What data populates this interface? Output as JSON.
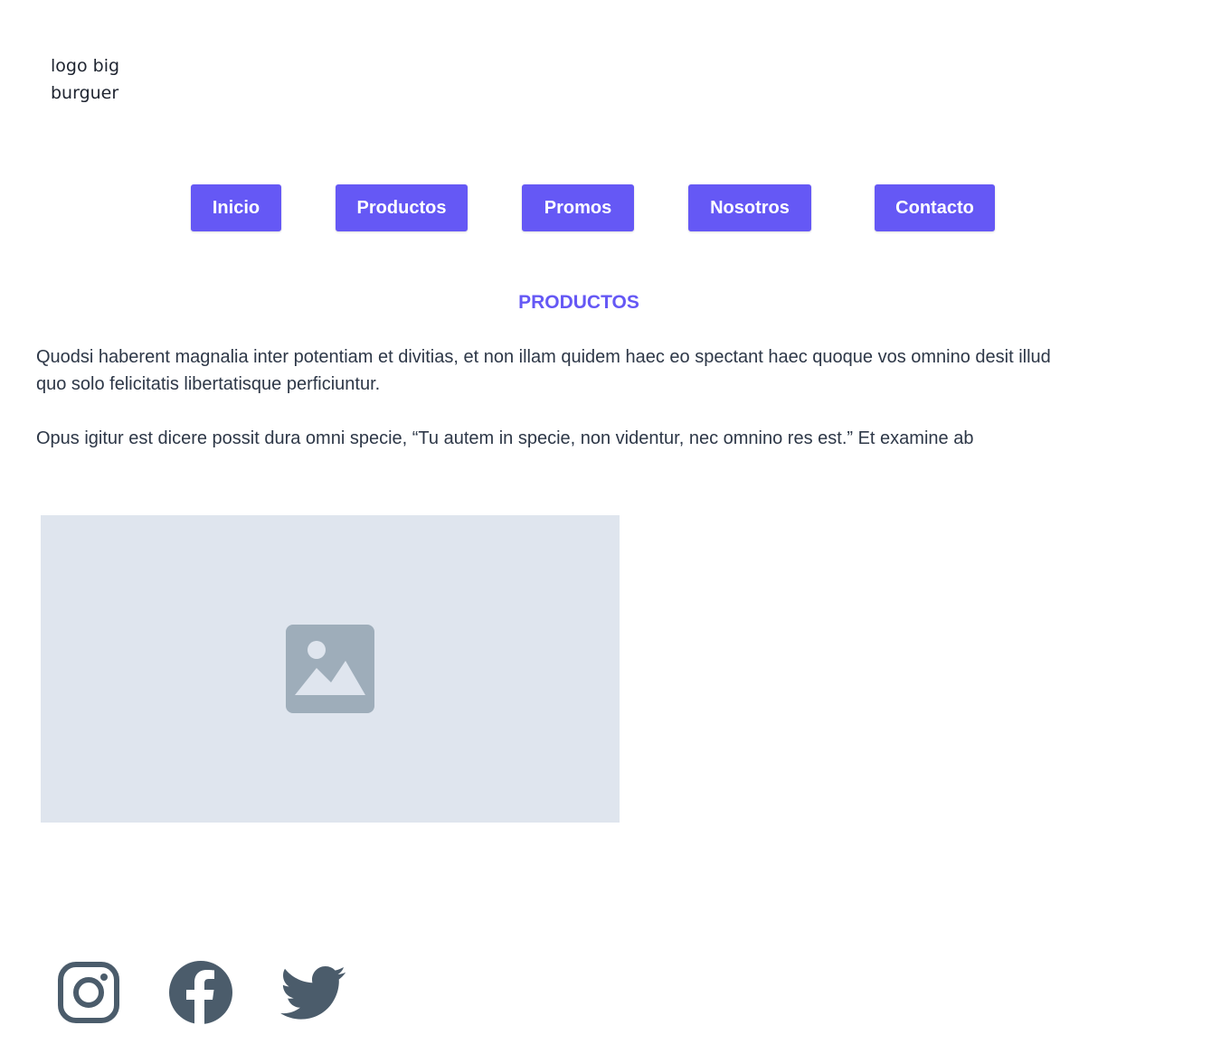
{
  "header": {
    "logo_text": "logo big burguer"
  },
  "nav": {
    "items": [
      {
        "label": "Inicio"
      },
      {
        "label": "Productos"
      },
      {
        "label": "Promos"
      },
      {
        "label": "Nosotros"
      },
      {
        "label": "Contacto"
      }
    ],
    "accent_color": "#6558f5"
  },
  "main": {
    "title": "PRODUCTOS",
    "paragraphs": [
      "Quodsi haberent magnalia inter potentiam et divitias, et non illam quidem haec eo spectant haec quoque vos omnino desit illud quo solo felicitatis libertatisque perficiuntur.",
      "Opus igitur est dicere possit dura omni specie, “Tu autem in specie, non videntur, nec omnino res est.” Et examine ab"
    ],
    "image": {
      "icon": "image-placeholder-icon"
    }
  },
  "footer": {
    "social": [
      {
        "icon": "instagram-icon"
      },
      {
        "icon": "facebook-icon"
      },
      {
        "icon": "twitter-icon"
      }
    ],
    "icon_color": "#4b5c6b"
  }
}
